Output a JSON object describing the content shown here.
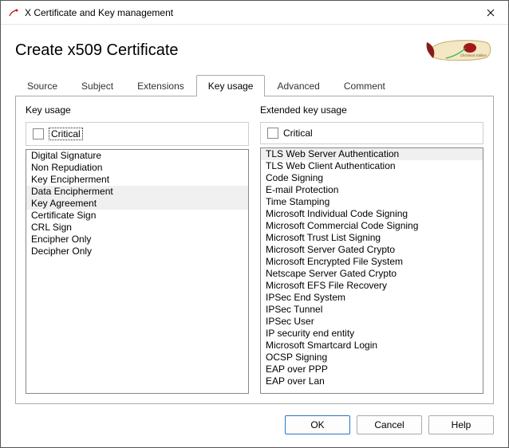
{
  "window": {
    "title": "X Certificate and Key management"
  },
  "header": {
    "title": "Create x509 Certificate"
  },
  "tabs": [
    {
      "label": "Source"
    },
    {
      "label": "Subject"
    },
    {
      "label": "Extensions"
    },
    {
      "label": "Key usage"
    },
    {
      "label": "Advanced"
    },
    {
      "label": "Comment"
    }
  ],
  "active_tab": 3,
  "key_usage": {
    "section_label": "Key usage",
    "critical_label": "Critical",
    "critical_checked": false,
    "items": [
      "Digital Signature",
      "Non Repudiation",
      "Key Encipherment",
      "Data Encipherment",
      "Key Agreement",
      "Certificate Sign",
      "CRL Sign",
      "Encipher Only",
      "Decipher Only"
    ],
    "selected_indices": [
      3,
      4
    ]
  },
  "extended_key_usage": {
    "section_label": "Extended key usage",
    "critical_label": "Critical",
    "critical_checked": false,
    "items": [
      "TLS Web Server Authentication",
      "TLS Web Client Authentication",
      "Code Signing",
      "E-mail Protection",
      "Time Stamping",
      "Microsoft Individual Code Signing",
      "Microsoft Commercial Code Signing",
      "Microsoft Trust List Signing",
      "Microsoft Server Gated Crypto",
      "Microsoft Encrypted File System",
      "Netscape Server Gated Crypto",
      "Microsoft EFS File Recovery",
      "IPSec End System",
      "IPSec Tunnel",
      "IPSec User",
      "IP security end entity",
      "Microsoft Smartcard Login",
      "OCSP Signing",
      "EAP over PPP",
      "EAP over Lan"
    ],
    "selected_indices": [
      0
    ]
  },
  "buttons": {
    "ok": "OK",
    "cancel": "Cancel",
    "help": "Help"
  }
}
